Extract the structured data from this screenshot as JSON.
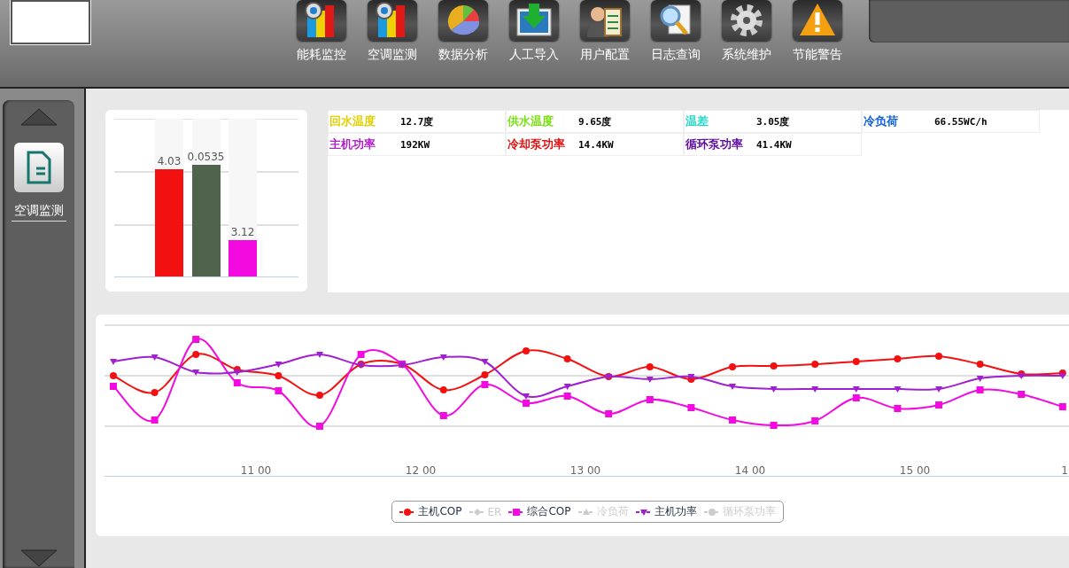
{
  "toolbar": [
    {
      "label": "能耗监控",
      "kind": "bars"
    },
    {
      "label": "空调监测",
      "kind": "bars"
    },
    {
      "label": "数据分析",
      "kind": "pie"
    },
    {
      "label": "人工导入",
      "kind": "import"
    },
    {
      "label": "用户配置",
      "kind": "user"
    },
    {
      "label": "日志查询",
      "kind": "search"
    },
    {
      "label": "系统维护",
      "kind": "gear"
    },
    {
      "label": "节能警告",
      "kind": "warning"
    }
  ],
  "sidebar": {
    "items": [
      {
        "label": "空调监测",
        "selected": true
      }
    ]
  },
  "bar_chart": {
    "bars": [
      {
        "value": "4.03",
        "color": "#f21010",
        "level": 0.68
      },
      {
        "value": "0.0535",
        "color": "#50634d",
        "level": 0.71
      },
      {
        "value": "3.12",
        "color": "#f20ae0",
        "level": 0.23
      }
    ]
  },
  "metrics": [
    {
      "label": "回水温度",
      "value": "12.7度",
      "color": "#e0d000"
    },
    {
      "label": "供水温度",
      "value": "9.65度",
      "color": "#78e010"
    },
    {
      "label": "温差",
      "value": "3.05度",
      "color": "#20d8c8"
    },
    {
      "label": "冷负荷",
      "value": "66.55WC/h",
      "color": "#1060e0"
    },
    {
      "label": "主机功率",
      "value": "192KW",
      "color": "#b020c8"
    },
    {
      "label": "冷却泵功率",
      "value": "14.4KW",
      "color": "#e01010"
    },
    {
      "label": "循环泵功率",
      "value": "41.4KW",
      "color": "#6010a0"
    }
  ],
  "line_chart": {
    "x_labels": [
      "11 00",
      "12 00",
      "13 00",
      "14 00",
      "15 00",
      "1"
    ],
    "legend": [
      {
        "label": "主机COP",
        "color": "#f21010",
        "visible": true,
        "kind": "circle"
      },
      {
        "label": "ER",
        "color": "#cccccc",
        "visible": false,
        "kind": "diamond"
      },
      {
        "label": "综合COP",
        "color": "#f20ae0",
        "visible": true,
        "kind": "square"
      },
      {
        "label": "冷负荷",
        "color": "#cccccc",
        "visible": false,
        "kind": "triangle"
      },
      {
        "label": "主机功率",
        "color": "#a020d0",
        "visible": true,
        "kind": "down"
      },
      {
        "label": "循环泵功率",
        "color": "#cccccc",
        "visible": false,
        "kind": "circle"
      }
    ]
  }
}
